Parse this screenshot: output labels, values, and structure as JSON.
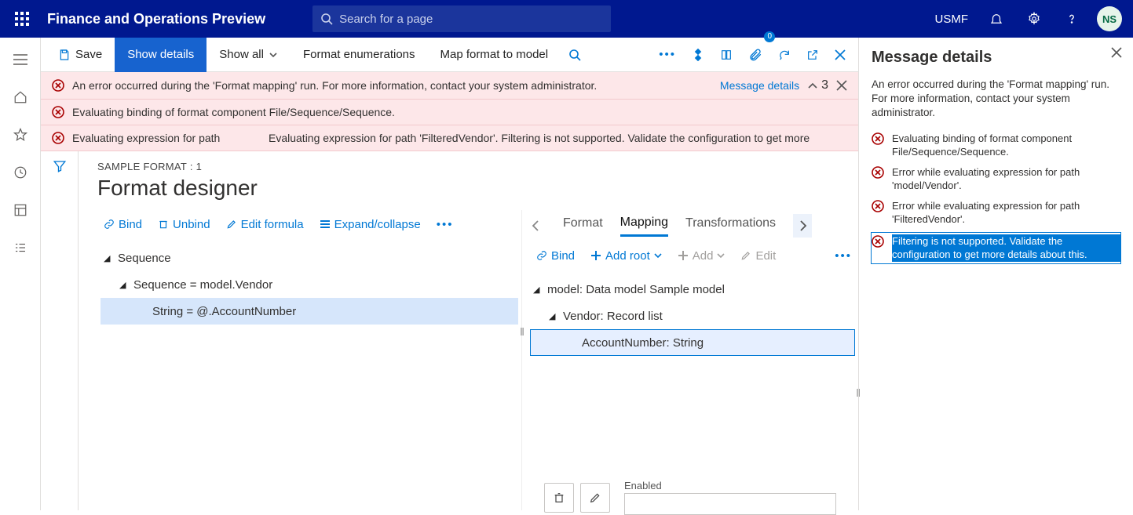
{
  "header": {
    "app_title": "Finance and Operations Preview",
    "search_placeholder": "Search for a page",
    "company": "USMF",
    "avatar_initials": "NS"
  },
  "cmdbar": {
    "save": "Save",
    "show_details": "Show details",
    "show_all": "Show all",
    "format_enum": "Format enumerations",
    "map_format": "Map format to model"
  },
  "errors": {
    "e1": "An error occurred during the 'Format mapping' run. For more information, contact your system administrator.",
    "e2": "Evaluating binding of format component File/Sequence/Sequence.",
    "e3_short": "Evaluating expression for path",
    "e3_long": "Evaluating expression for path 'FilteredVendor'. Filtering is not supported. Validate the configuration to get more",
    "link": "Message details",
    "count": "3"
  },
  "designer": {
    "crumb": "SAMPLE FORMAT : 1",
    "title": "Format designer",
    "toolbar": {
      "bind": "Bind",
      "unbind": "Unbind",
      "edit_formula": "Edit formula",
      "expand": "Expand/collapse"
    },
    "tabs": {
      "format": "Format",
      "mapping": "Mapping",
      "transformations": "Transformations"
    },
    "left_tree": {
      "n1": "Sequence",
      "n2": "Sequence = model.Vendor",
      "n3": "String = @.AccountNumber"
    },
    "right_toolbar": {
      "bind": "Bind",
      "add_root": "Add root",
      "add": "Add",
      "edit": "Edit"
    },
    "right_tree": {
      "n1": "model: Data model Sample model",
      "n2": "Vendor: Record list",
      "n3": "AccountNumber: String"
    },
    "bottom": {
      "enabled": "Enabled"
    }
  },
  "panel": {
    "title": "Message details",
    "summary": "An error occurred during the 'Format mapping' run. For more information, contact your system administrator.",
    "items": {
      "i1": "Evaluating binding of format component File/Sequence/Sequence.",
      "i2": "Error while evaluating expression for path 'model/Vendor'.",
      "i3": "Error while evaluating expression for path 'FilteredVendor'.",
      "i4": "Filtering is not supported. Validate the configuration to get more details about this."
    }
  }
}
